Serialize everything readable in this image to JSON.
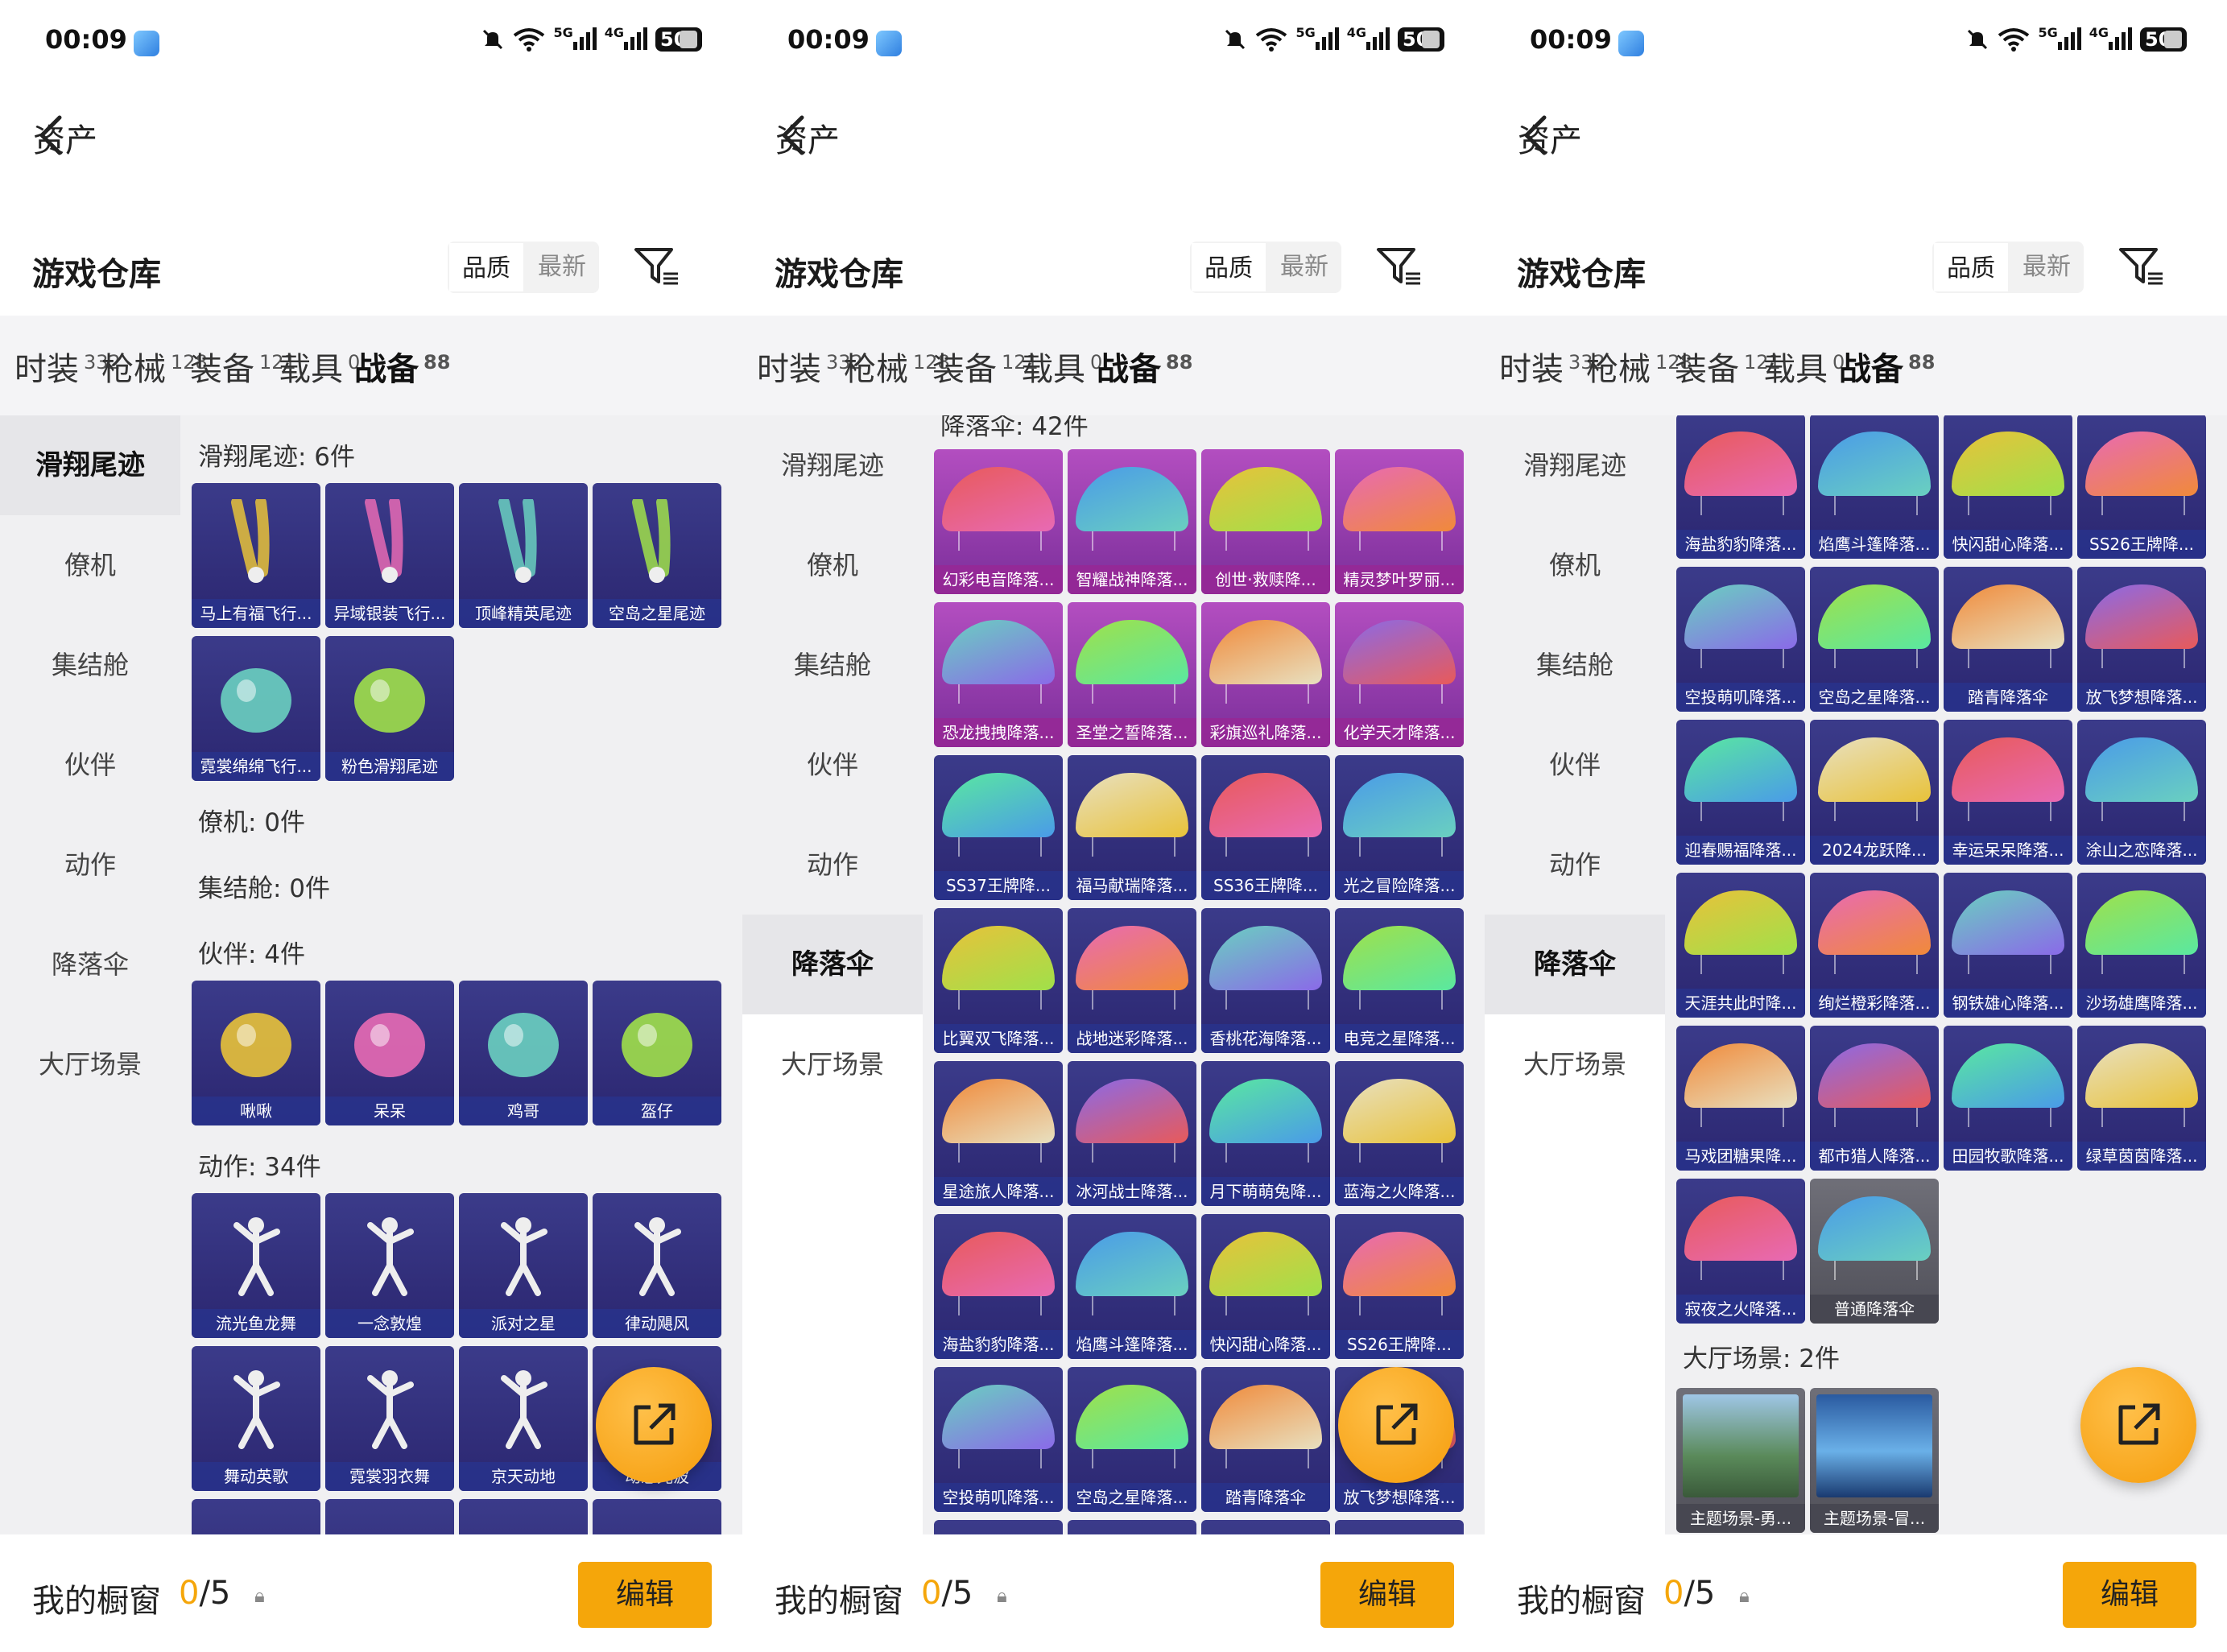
{
  "status": {
    "time": "00:09",
    "signal1": "5G",
    "signal2": "4G",
    "battery": "50"
  },
  "nav": {
    "title": "资产"
  },
  "header": {
    "warehouse": "游戏仓库",
    "sort_quality": "品质",
    "sort_latest": "最新"
  },
  "tabs": [
    {
      "label": "时装",
      "count": "332"
    },
    {
      "label": "枪械",
      "count": "128"
    },
    {
      "label": "装备",
      "count": "121"
    },
    {
      "label": "载具",
      "count": "0"
    },
    {
      "label": "战备",
      "count": "88"
    }
  ],
  "sidebar": [
    "滑翔尾迹",
    "僚机",
    "集结舱",
    "伙伴",
    "动作",
    "降落伞",
    "大厅场景"
  ],
  "panel1": {
    "sec_trail": "滑翔尾迹: 6件",
    "trail_items": [
      "马上有福飞行...",
      "异域银装飞行...",
      "顶峰精英尾迹",
      "空岛之星尾迹",
      "霓裳绵绵飞行...",
      "粉色滑翔尾迹"
    ],
    "sec_wing": "僚机: 0件",
    "sec_pod": "集结舱: 0件",
    "sec_partner": "伙伴: 4件",
    "partner_items": [
      "啾啾",
      "呆呆",
      "鸡哥",
      "盔仔"
    ],
    "sec_emote": "动作: 34件",
    "emote_items": [
      "流光鱼龙舞",
      "一念敦煌",
      "派对之星",
      "律动飓风",
      "舞动英歌",
      "霓裳羽衣舞",
      "京天动地",
      "动感光波"
    ]
  },
  "panel2": {
    "sec_chute_partial": "降落伞: 42件",
    "chute_items": [
      "幻彩电音降落...",
      "智耀战神降落...",
      "创世·救赎降...",
      "精灵梦叶罗丽...",
      "恐龙拽拽降落...",
      "圣堂之誓降落...",
      "彩旗巡礼降落...",
      "化学天才降落...",
      "SS37王牌降...",
      "福马献瑞降落...",
      "SS36王牌降...",
      "光之冒险降落...",
      "比翼双飞降落...",
      "战地迷彩降落...",
      "香桃花海降落...",
      "电竞之星降落...",
      "星途旅人降落...",
      "冰河战士降落...",
      "月下萌萌兔降...",
      "蓝海之火降落...",
      "海盐豹豹降落...",
      "焰鹰斗篷降落...",
      "快闪甜心降落...",
      "SS26王牌降...",
      "空投萌叽降落...",
      "空岛之星降落...",
      "踏青降落伞",
      "放飞梦想降落..."
    ]
  },
  "panel3": {
    "chute_items": [
      "海盐豹豹降落...",
      "焰鹰斗篷降落...",
      "快闪甜心降落...",
      "SS26王牌降...",
      "空投萌叽降落...",
      "空岛之星降落...",
      "踏青降落伞",
      "放飞梦想降落...",
      "迎春赐福降落...",
      "2024龙跃降...",
      "幸运呆呆降落...",
      "涂山之恋降落...",
      "天涯共此时降...",
      "绚烂橙彩降落...",
      "钢铁雄心降落...",
      "沙场雄鹰降落...",
      "马戏团糖果降...",
      "都市猎人降落...",
      "田园牧歌降落...",
      "绿草茵茵降落...",
      "寂夜之火降落...",
      "普通降落伞"
    ],
    "sec_scene": "大厅场景: 2件",
    "scene_items": [
      "主题场景-勇...",
      "主题场景-冒..."
    ]
  },
  "bottom": {
    "window_label": "我的橱窗",
    "count_current": "0",
    "count_total": "/5",
    "edit_label": "编辑"
  },
  "colors": {
    "accent": "#f5a60a",
    "card_purple": "#3b3b8a",
    "card_pink": "#b34ec0"
  }
}
